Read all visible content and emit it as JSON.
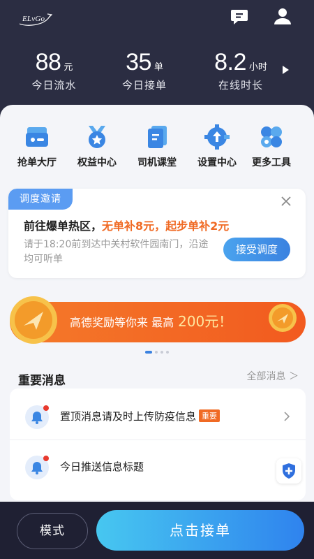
{
  "header": {
    "logo_text": "ELvGo",
    "icons": [
      "message-icon",
      "user-icon"
    ]
  },
  "stats": [
    {
      "value": "88",
      "unit": "元",
      "label": "今日流水"
    },
    {
      "value": "35",
      "unit": "单",
      "label": "今日接单"
    },
    {
      "value": "8.2",
      "unit": "小时",
      "label": "在线时长"
    }
  ],
  "tools": [
    {
      "label": "抢单大厅",
      "icon": "order-hall-icon"
    },
    {
      "label": "权益中心",
      "icon": "medal-icon"
    },
    {
      "label": "司机课堂",
      "icon": "book-icon"
    },
    {
      "label": "设置中心",
      "icon": "gear-icon"
    },
    {
      "label": "更多工具",
      "icon": "more-tools-icon"
    }
  ],
  "dispatch": {
    "tag": "调度邀请",
    "title_prefix": "前往爆单热区，",
    "title_highlight": "无单补8元，起步单补2元",
    "description": "请于18:20前到达中关村软件园南门，沿途均可听单",
    "accept_label": "接受调度"
  },
  "banner": {
    "text": "高德奖励等你来 最高",
    "amount": "200元！"
  },
  "messages": {
    "heading": "重要消息",
    "all_link": "全部消息 ＞",
    "items": [
      {
        "text": "置顶消息请及时上传防疫信息",
        "badge": "重要"
      },
      {
        "text": "今日推送信息标题",
        "badge": ""
      }
    ]
  },
  "bottom": {
    "mode_label": "模式",
    "take_order_label": "点击接单"
  },
  "colors": {
    "header_bg": "#2b2d42",
    "accent_blue": "#3b82e0",
    "accent_orange": "#f06a24"
  }
}
